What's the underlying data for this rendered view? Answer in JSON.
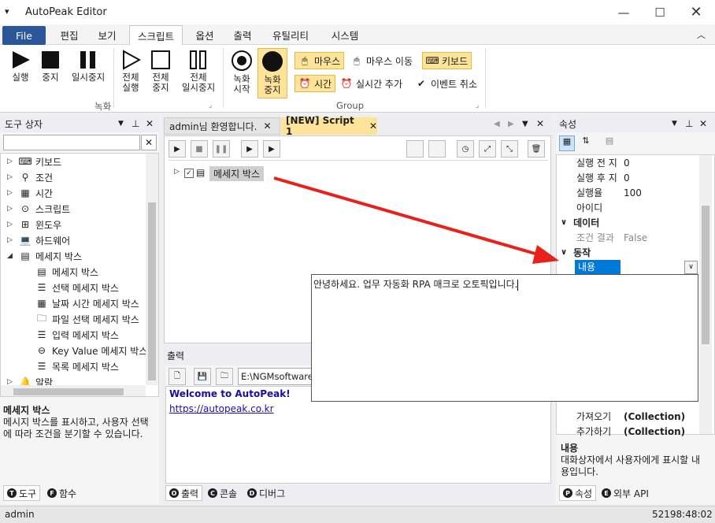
{
  "title": "AutoPeak Editor",
  "menu": [
    "File",
    "편집",
    "보기",
    "스크립트",
    "옵션",
    "출력",
    "유틸리티",
    "시스템"
  ],
  "ribbon": {
    "run": "실행",
    "stop": "중지",
    "pause": "일시중지",
    "run_all": "전체\n실행",
    "stop_all": "전체\n중지",
    "pause_all": "전체\n일시중지",
    "rec_start": "녹화\n시작",
    "rec_stop": "녹화\n중지",
    "group_record": "녹화",
    "mouse_click": "마우스",
    "mouse_move": "마우스 이동",
    "keyboard": "키보드",
    "time": "시간",
    "realtime_add": "실시간 추가",
    "event_cancel": "이벤트 취소",
    "group_group": "Group"
  },
  "toolbox": {
    "title": "도구 상자",
    "items": [
      "키보드",
      "조건",
      "시간",
      "스크립트",
      "윈도우",
      "하드웨어",
      "메세지 박스"
    ],
    "sub": [
      "메세지 박스",
      "선택 메세지 박스",
      "날짜 시간 메세지 박스",
      "파일 선택 메세지 박스",
      "입력 메세지 박스",
      "Key Value 메세지 박스",
      "목록 메세지 박스"
    ],
    "last": "알람",
    "desc_title": "메세지 박스",
    "desc": "메시지 박스를 표시하고, 사용자 선택에 따라 조건을 분기할 수 있습니다.",
    "tab_tools": "도구",
    "tab_func": "함수"
  },
  "editor": {
    "tab1": "admin님 환영합니다.",
    "tab2": "[NEW] Script 1",
    "node": "메세지 박스"
  },
  "output": {
    "title": "출력",
    "path": "E:\\NGMsoftware\\",
    "line1": "Welcome to AutoPeak!",
    "line2": "https://autopeak.co.kr",
    "tab_output": "출력",
    "tab_console": "콘솔",
    "tab_debug": "디버그"
  },
  "props": {
    "title": "속성",
    "rows": [
      [
        "실행 전 지",
        "0"
      ],
      [
        "실행 후 지",
        "0"
      ],
      [
        "실행율",
        "100"
      ],
      [
        "아이디",
        ""
      ]
    ],
    "cat_data": "데이터",
    "cond_result": "조건 결과",
    "cond_value": "False",
    "cat_action": "동작",
    "content": "내용",
    "rows2": [
      [
        "가져오기",
        "(Collection)"
      ],
      [
        "추가하기",
        "(Collection)"
      ]
    ],
    "desc_title": "내용",
    "desc": "대화상자에서 사용자에게 표시할 내용입니다.",
    "tab_props": "속성",
    "tab_api": "외부 API"
  },
  "popup_text": "안녕하세요. 업무 자동화 RPA 매크로 오토픽입니다.",
  "status": {
    "user": "admin",
    "time": "52198:48:02"
  },
  "colors": {
    "accent": "#2b579a",
    "highlight": "#fde499",
    "arrow": "#e8221b",
    "link": "#1a0dab"
  }
}
